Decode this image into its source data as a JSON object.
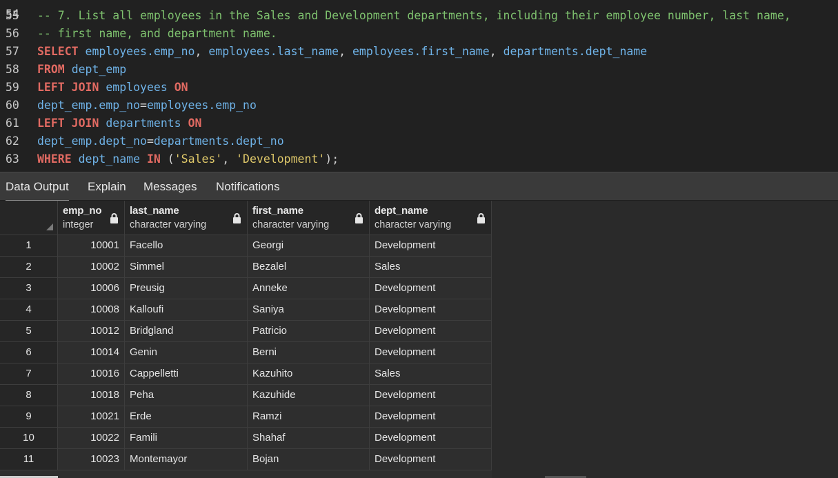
{
  "editor": {
    "lines": [
      {
        "num": "55",
        "tokens": [
          {
            "t": "-- 7. List all employees in the Sales and Development departments, including their employee number, last name,",
            "c": "cm"
          }
        ]
      },
      {
        "num": "56",
        "tokens": [
          {
            "t": "-- first name, and department name.",
            "c": "cm"
          }
        ]
      },
      {
        "num": "57",
        "tokens": [
          {
            "t": "SELECT",
            "c": "kw"
          },
          {
            "t": " ",
            "c": "pl"
          },
          {
            "t": "employees.emp_no",
            "c": "id"
          },
          {
            "t": ", ",
            "c": "pl"
          },
          {
            "t": "employees.last_name",
            "c": "id"
          },
          {
            "t": ", ",
            "c": "pl"
          },
          {
            "t": "employees.first_name",
            "c": "id"
          },
          {
            "t": ", ",
            "c": "pl"
          },
          {
            "t": "departments.dept_name",
            "c": "id"
          }
        ]
      },
      {
        "num": "58",
        "tokens": [
          {
            "t": "FROM",
            "c": "kw"
          },
          {
            "t": " ",
            "c": "pl"
          },
          {
            "t": "dept_emp",
            "c": "id"
          }
        ]
      },
      {
        "num": "59",
        "tokens": [
          {
            "t": "LEFT JOIN",
            "c": "kw"
          },
          {
            "t": " ",
            "c": "pl"
          },
          {
            "t": "employees",
            "c": "id"
          },
          {
            "t": " ",
            "c": "pl"
          },
          {
            "t": "ON",
            "c": "kw"
          }
        ]
      },
      {
        "num": "60",
        "tokens": [
          {
            "t": "dept_emp.emp_no",
            "c": "id"
          },
          {
            "t": "=",
            "c": "pl"
          },
          {
            "t": "employees.emp_no",
            "c": "id"
          }
        ]
      },
      {
        "num": "61",
        "tokens": [
          {
            "t": "LEFT JOIN",
            "c": "kw"
          },
          {
            "t": " ",
            "c": "pl"
          },
          {
            "t": "departments",
            "c": "id"
          },
          {
            "t": " ",
            "c": "pl"
          },
          {
            "t": "ON",
            "c": "kw"
          }
        ]
      },
      {
        "num": "62",
        "tokens": [
          {
            "t": "dept_emp.dept_no",
            "c": "id"
          },
          {
            "t": "=",
            "c": "pl"
          },
          {
            "t": "departments.dept_no",
            "c": "id"
          }
        ]
      },
      {
        "num": "63",
        "tokens": [
          {
            "t": "WHERE",
            "c": "kw"
          },
          {
            "t": " ",
            "c": "pl"
          },
          {
            "t": "dept_name",
            "c": "id"
          },
          {
            "t": " ",
            "c": "pl"
          },
          {
            "t": "IN",
            "c": "kw"
          },
          {
            "t": " (",
            "c": "pl"
          },
          {
            "t": "'Sales'",
            "c": "st"
          },
          {
            "t": ", ",
            "c": "pl"
          },
          {
            "t": "'Development'",
            "c": "st"
          },
          {
            "t": ");",
            "c": "pl"
          }
        ]
      }
    ]
  },
  "tabs": [
    {
      "label": "Data Output"
    },
    {
      "label": "Explain"
    },
    {
      "label": "Messages"
    },
    {
      "label": "Notifications"
    }
  ],
  "grid": {
    "columns": [
      {
        "name": "emp_no",
        "type": "integer",
        "icon": "lock-icon"
      },
      {
        "name": "last_name",
        "type": "character varying",
        "icon": "lock-icon"
      },
      {
        "name": "first_name",
        "type": "character varying",
        "icon": "lock-icon"
      },
      {
        "name": "dept_name",
        "type": "character varying",
        "icon": "lock-icon"
      }
    ],
    "rows": [
      {
        "idx": "1",
        "emp_no": "10001",
        "last_name": "Facello",
        "first_name": "Georgi",
        "dept_name": "Development"
      },
      {
        "idx": "2",
        "emp_no": "10002",
        "last_name": "Simmel",
        "first_name": "Bezalel",
        "dept_name": "Sales"
      },
      {
        "idx": "3",
        "emp_no": "10006",
        "last_name": "Preusig",
        "first_name": "Anneke",
        "dept_name": "Development"
      },
      {
        "idx": "4",
        "emp_no": "10008",
        "last_name": "Kalloufi",
        "first_name": "Saniya",
        "dept_name": "Development"
      },
      {
        "idx": "5",
        "emp_no": "10012",
        "last_name": "Bridgland",
        "first_name": "Patricio",
        "dept_name": "Development"
      },
      {
        "idx": "6",
        "emp_no": "10014",
        "last_name": "Genin",
        "first_name": "Berni",
        "dept_name": "Development"
      },
      {
        "idx": "7",
        "emp_no": "10016",
        "last_name": "Cappelletti",
        "first_name": "Kazuhito",
        "dept_name": "Sales"
      },
      {
        "idx": "8",
        "emp_no": "10018",
        "last_name": "Peha",
        "first_name": "Kazuhide",
        "dept_name": "Development"
      },
      {
        "idx": "9",
        "emp_no": "10021",
        "last_name": "Erde",
        "first_name": "Ramzi",
        "dept_name": "Development"
      },
      {
        "idx": "10",
        "emp_no": "10022",
        "last_name": "Famili",
        "first_name": "Shahaf",
        "dept_name": "Development"
      },
      {
        "idx": "11",
        "emp_no": "10023",
        "last_name": "Montemayor",
        "first_name": "Bojan",
        "dept_name": "Development"
      }
    ]
  },
  "colors": {
    "comment": "#7ec16e",
    "keyword": "#e16a62",
    "identifier": "#6fb3e8",
    "string": "#e0c96a"
  }
}
